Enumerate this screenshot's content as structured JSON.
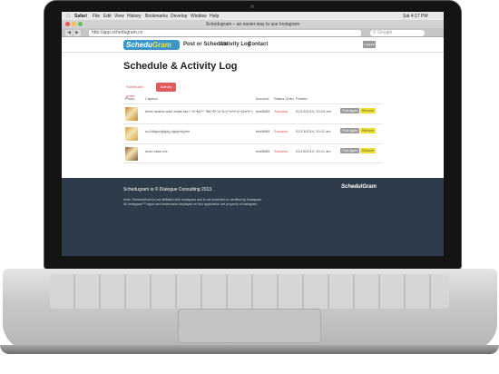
{
  "menubar": {
    "app": "Safari",
    "items": [
      "File",
      "Edit",
      "View",
      "History",
      "Bookmarks",
      "Develop",
      "Window",
      "Help"
    ],
    "clock": "Sat 4:17 PM"
  },
  "browser": {
    "title": "Schedugram – an easier way to use Instagram",
    "url": "http://app.schedugram.co",
    "search_placeholder": "Google"
  },
  "app": {
    "logo_pre": "Schedu",
    "logo_post": "Gram",
    "nav": [
      "Post or Schedule",
      "Activity Log",
      "Contact"
    ],
    "logout": "Logout"
  },
  "page": {
    "title": "Schedule & Activity Log",
    "tabs": [
      "Scheduled posts",
      "Activity"
    ]
  },
  "table": {
    "headers": [
      "Photo",
      "Caption",
      "Account",
      "Status Child",
      "Posted"
    ],
    "rows": [
      {
        "caption": "#test asdfas adsf asfas fas f *&^$&** ^$&^$*^&^&^(*%%^&^)&#%^)",
        "account": "test8685",
        "status": "Success",
        "posted": "01/13/2014, 20:04 am",
        "post_again": "Post again",
        "remove": "Remove",
        "thumb_color": "#c8872e"
      },
      {
        "caption": "uu2ddgsdgfgdg dgfgrrdghm",
        "account": "test8685",
        "status": "Success",
        "posted": "01/13/2014, 20:11 am",
        "post_again": "Post again",
        "remove": "Remove",
        "thumb_color": "#d8a33a"
      },
      {
        "caption": "#can sass ms",
        "account": "test8685",
        "status": "Success",
        "posted": "01/13/2014, 20:11 am",
        "post_again": "Post again",
        "remove": "Remove",
        "thumb_color": "#8a5a3a"
      }
    ]
  },
  "footer": {
    "copyright": "Schedugram is © Dialogue Consulting 2013.",
    "disclaimer1": "Note: SchedulGram is not affiliated with Instagram and is not endorsed or certified by Instagram.",
    "disclaimer2": "All Instagram™ logos and trademarks displayed on this application are property of Instagram.",
    "logo": "SchedulGram"
  },
  "colors": {
    "accent": "#e15b5b",
    "brand": "#3c96c9",
    "footer_bg": "#2d3b4a",
    "remove_btn": "#f0e02c"
  }
}
